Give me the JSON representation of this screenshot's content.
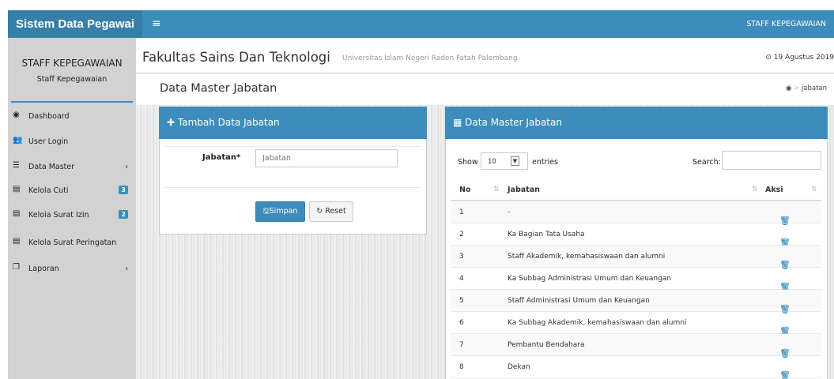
{
  "header": {
    "app_name": "Sistem Data Pegawai",
    "menu_icon": "hamburger-icon",
    "user_label": "STAFF KEPEGAWAIAN"
  },
  "sidebar": {
    "name": "STAFF KEPEGAWAIAN",
    "role": "Staff Kepegawaian",
    "items": [
      {
        "label": "Dashboard",
        "icon": "dashboard-icon"
      },
      {
        "label": "User Login",
        "icon": "users-icon"
      },
      {
        "label": "Data Master",
        "icon": "list-icon",
        "chevron": "‹"
      },
      {
        "label": "Kelola Cuti",
        "icon": "table-icon",
        "badge": "3"
      },
      {
        "label": "Kelola Surat Izin",
        "icon": "table-icon",
        "badge": "2"
      },
      {
        "label": "Kelola Surat Peringatan",
        "icon": "table-icon"
      },
      {
        "label": "Laporan",
        "icon": "copy-icon",
        "chevron": "‹"
      }
    ]
  },
  "page": {
    "title": "Fakultas Sains Dan Teknologi",
    "subtitle": "Universitas Islam Negeri Raden Fatah Palembang",
    "date": "19 Agustus 2019",
    "content_title": "Data Master Jabatan",
    "breadcrumb": "jabatan"
  },
  "form": {
    "title": "Tambah Data Jabatan",
    "field_label": "Jabatan*",
    "field_placeholder": "Jabatan",
    "save_label": "Simpan",
    "reset_label": "Reset"
  },
  "table": {
    "title": "Data Master Jabatan",
    "show_label": "Show",
    "page_length": "10",
    "entries_label": "entries",
    "search_label": "Search:",
    "columns": [
      "No",
      "Jabatan",
      "Aksi"
    ],
    "rows": [
      {
        "no": "1",
        "jabatan": "-"
      },
      {
        "no": "2",
        "jabatan": "Ka Bagian Tata Usaha"
      },
      {
        "no": "3",
        "jabatan": "Staff Akademik, kemahasiswaan dan alumni"
      },
      {
        "no": "4",
        "jabatan": "Ka Subbag Administrasi Umum dan Keuangan"
      },
      {
        "no": "5",
        "jabatan": "Staff Administrasi Umum dan Keuangan"
      },
      {
        "no": "6",
        "jabatan": "Ka Subbag Akademik, kemahasiswaan dan alumni"
      },
      {
        "no": "7",
        "jabatan": "Pembantu Bendahara"
      },
      {
        "no": "8",
        "jabatan": "Dekan"
      }
    ]
  },
  "colors": {
    "primary": "#3c8dbc",
    "brand_bg": "#367fa9",
    "sidebar_bg": "#d2d2d2"
  }
}
